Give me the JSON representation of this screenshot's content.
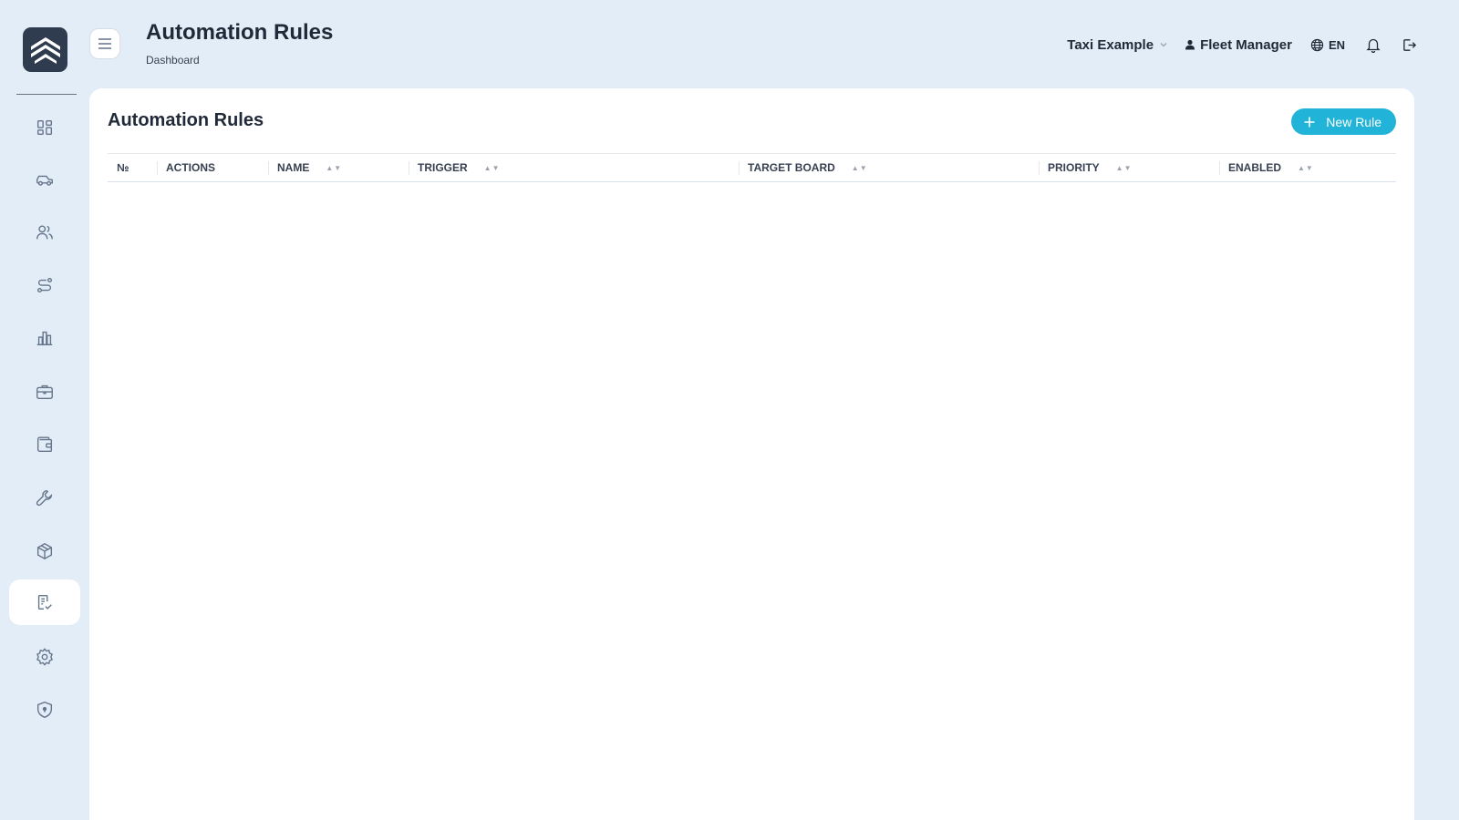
{
  "header": {
    "title": "Automation Rules",
    "breadcrumb": "Dashboard",
    "company": "Taxi Example",
    "user": "Fleet Manager",
    "language": "EN"
  },
  "sidebar": {
    "items": [
      {
        "icon": "dashboard-icon"
      },
      {
        "icon": "car-icon"
      },
      {
        "icon": "users-icon"
      },
      {
        "icon": "route-icon"
      },
      {
        "icon": "chart-icon"
      },
      {
        "icon": "briefcase-icon"
      },
      {
        "icon": "wallet-icon"
      },
      {
        "icon": "wrench-icon"
      },
      {
        "icon": "box-icon"
      },
      {
        "icon": "rules-icon",
        "active": true
      },
      {
        "icon": "gear-icon"
      },
      {
        "icon": "shield-icon"
      }
    ]
  },
  "main": {
    "card_title": "Automation Rules",
    "new_rule_label": "New Rule",
    "table": {
      "columns": [
        {
          "label": "№",
          "sortable": false
        },
        {
          "label": "ACTIONS",
          "sortable": false
        },
        {
          "label": "NAME",
          "sortable": true
        },
        {
          "label": "TRIGGER",
          "sortable": true
        },
        {
          "label": "TARGET BOARD",
          "sortable": true
        },
        {
          "label": "PRIORITY",
          "sortable": true
        },
        {
          "label": "ENABLED",
          "sortable": true
        }
      ],
      "rows": []
    }
  },
  "colors": {
    "background": "#e3edf7",
    "accent": "#22b4d8",
    "logo_bg": "#2f3c4f",
    "icon": "#64748b"
  }
}
